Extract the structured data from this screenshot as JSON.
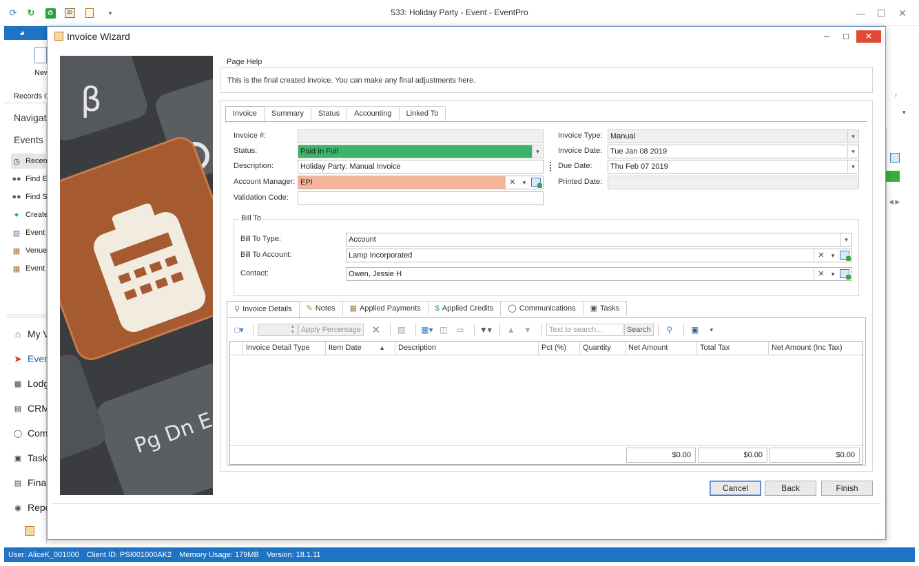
{
  "app": {
    "title": "533: Holiday Party - Event - EventPro",
    "ribbon_new": "New",
    "ribbon_records": "Records C",
    "nav_title": "Navigati",
    "nav_events": "Events",
    "nav_small_items": [
      "Recen",
      "Find E",
      "Find S",
      "Create",
      "Event",
      "Venue",
      "Event"
    ],
    "nav_big_items": [
      "My V",
      "Even",
      "Lodg",
      "CRM",
      "Com",
      "Task",
      "Fina",
      "Repo"
    ]
  },
  "status_bar": {
    "user": "User: AliceK_001000",
    "client_id": "Client ID: PSI001000AK2",
    "memory": "Memory Usage: 179MB",
    "version": "Version: 18.1.11"
  },
  "dialog": {
    "title": "Invoice Wizard",
    "page_help_label": "Page Help",
    "page_help_text": "This is the final created invoice.  You can make any final adjustments here.",
    "tabs": [
      "Invoice",
      "Summary",
      "Status",
      "Accounting",
      "Linked To"
    ],
    "fields": {
      "invoice_no_label": "Invoice #:",
      "invoice_no_value": "",
      "status_label": "Status:",
      "status_value": "Paid In Full",
      "description_label": "Description:",
      "description_value": "Holiday Party: Manual Invoice",
      "account_manager_label": "Account Manager:",
      "account_manager_value": "EPI",
      "validation_code_label": "Validation Code:",
      "validation_code_value": "",
      "invoice_type_label": "Invoice Type:",
      "invoice_type_value": "Manual",
      "invoice_date_label": "Invoice Date:",
      "invoice_date_value": "Tue Jan 08 2019",
      "due_date_label": "Due Date:",
      "due_date_value": "Thu Feb 07 2019",
      "printed_date_label": "Printed Date:",
      "printed_date_value": ""
    },
    "bill_to": {
      "label": "Bill To",
      "type_label": "Bill To Type:",
      "type_value": "Account",
      "account_label": "Bill To Account:",
      "account_value": "Lamp Incorporated",
      "contact_label": "Contact:",
      "contact_value": "Owen, Jessie H"
    },
    "detail_tabs": [
      "Invoice Details",
      "Notes",
      "Applied Payments",
      "Applied Credits",
      "Communications",
      "Tasks"
    ],
    "toolbar": {
      "apply_percentage": "Apply Percentage",
      "search_placeholder": "Text to search...",
      "search_button": "Search"
    },
    "grid": {
      "columns": [
        "Invoice Detail Type",
        "Item Date",
        "Description",
        "Pct (%)",
        "Quantity",
        "Net Amount",
        "Total Tax",
        "Net Amount (Inc Tax)"
      ],
      "totals": [
        "$0.00",
        "$0.00",
        "$0.00"
      ]
    },
    "buttons": {
      "cancel": "Cancel",
      "back": "Back",
      "finish": "Finish"
    }
  },
  "colors": {
    "status_paid": "#3db36b",
    "account_manager_bg": "#f5b49a",
    "brand_blue": "#1e73c4",
    "close_red": "#e04a35"
  }
}
